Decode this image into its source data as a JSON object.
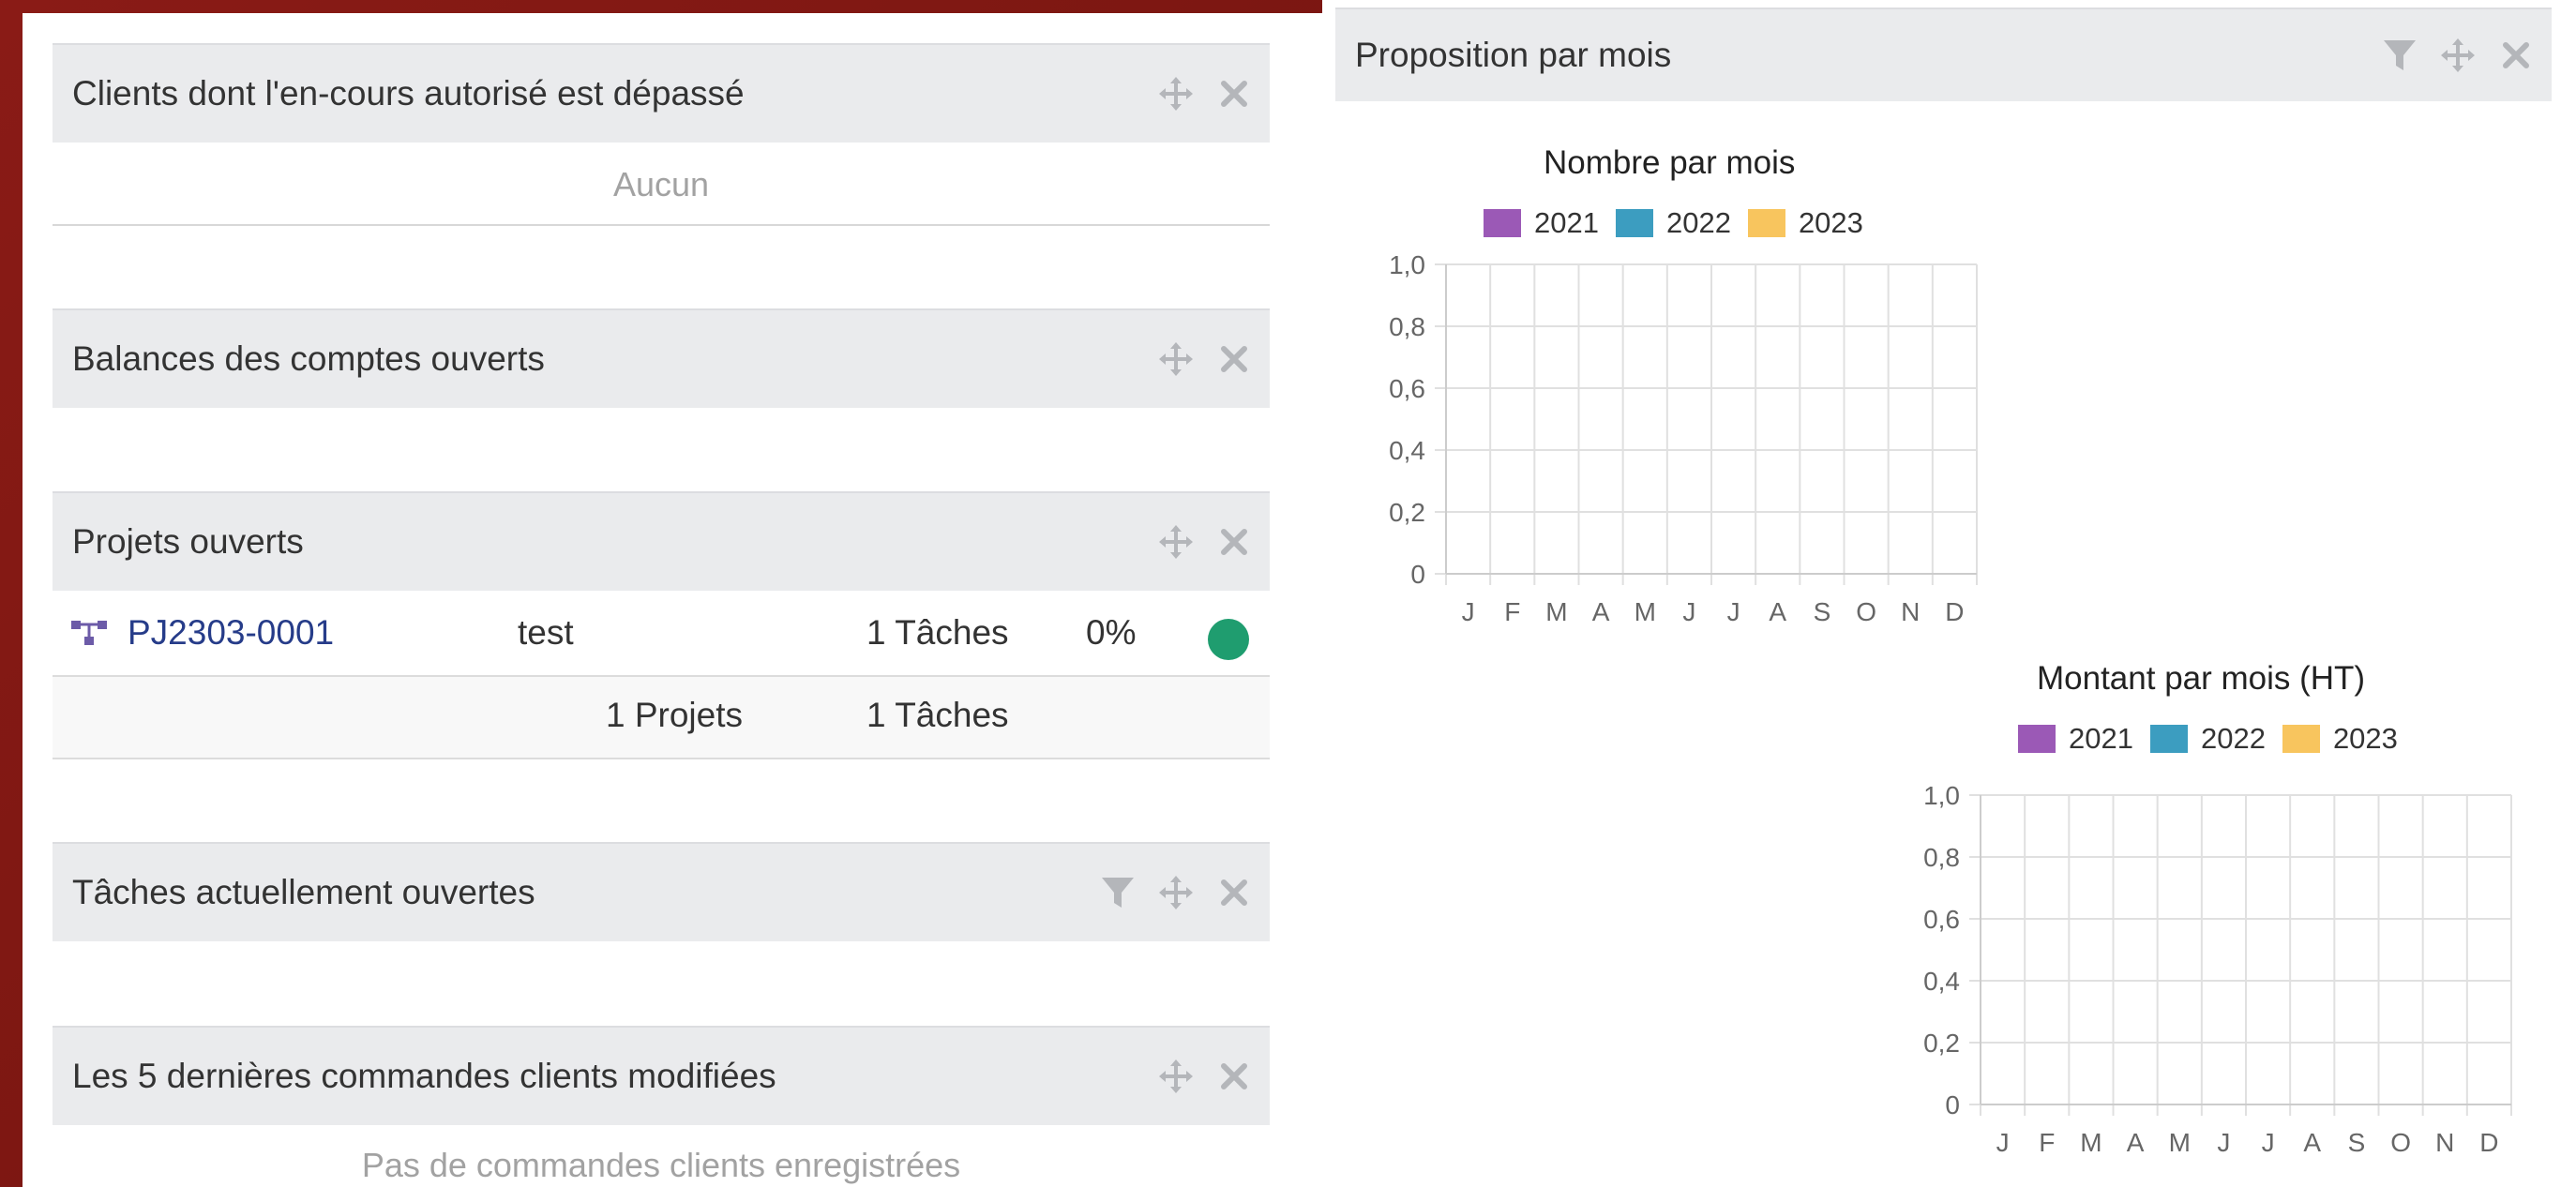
{
  "colors": {
    "header_bg": "#eaebed",
    "link": "#263c89",
    "status_green": "#1f9d6f",
    "series_2021": "#9b59b6",
    "series_2022": "#3c9dc0",
    "series_2023": "#f8c55e",
    "frame": "#8a1b16"
  },
  "widgets": {
    "overdue_clients": {
      "title": "Clients dont l'en-cours autorisé est dépassé",
      "empty": "Aucun"
    },
    "balances": {
      "title": "Balances des comptes ouverts"
    },
    "open_projects": {
      "title": "Projets ouverts",
      "row": {
        "ref": "PJ2303-0001",
        "label": "test",
        "tasks": "1 Tâches",
        "progress": "0%",
        "status": "status-green"
      },
      "totals": {
        "projects": "1 Projets",
        "tasks": "1 Tâches"
      }
    },
    "open_tasks": {
      "title": "Tâches actuellement ouvertes"
    },
    "last_orders": {
      "title": "Les 5 dernières commandes clients modifiées",
      "empty": "Pas de commandes clients enregistrées"
    },
    "proposals": {
      "title": "Proposition par mois"
    }
  },
  "icons": {
    "move": "move-arrows-icon",
    "close": "close-icon",
    "filter": "filter-icon",
    "project": "project-tree-icon"
  },
  "chart_data": [
    {
      "type": "bar",
      "title": "Nombre par mois",
      "categories": [
        "J",
        "F",
        "M",
        "A",
        "M",
        "J",
        "J",
        "A",
        "S",
        "O",
        "N",
        "D"
      ],
      "series": [
        {
          "name": "2021",
          "values": [
            0,
            0,
            0,
            0,
            0,
            0,
            0,
            0,
            0,
            0,
            0,
            0
          ]
        },
        {
          "name": "2022",
          "values": [
            0,
            0,
            0,
            0,
            0,
            0,
            0,
            0,
            0,
            0,
            0,
            0
          ]
        },
        {
          "name": "2023",
          "values": [
            0,
            0,
            0,
            0,
            0,
            0,
            0,
            0,
            0,
            0,
            0,
            0
          ]
        }
      ],
      "yticks": [
        "0",
        "0,2",
        "0,4",
        "0,6",
        "0,8",
        "1,0"
      ],
      "ylim": [
        0,
        1
      ],
      "grid": true,
      "legend": "top"
    },
    {
      "type": "bar",
      "title": "Montant par mois (HT)",
      "categories": [
        "J",
        "F",
        "M",
        "A",
        "M",
        "J",
        "J",
        "A",
        "S",
        "O",
        "N",
        "D"
      ],
      "series": [
        {
          "name": "2021",
          "values": [
            0,
            0,
            0,
            0,
            0,
            0,
            0,
            0,
            0,
            0,
            0,
            0
          ]
        },
        {
          "name": "2022",
          "values": [
            0,
            0,
            0,
            0,
            0,
            0,
            0,
            0,
            0,
            0,
            0,
            0
          ]
        },
        {
          "name": "2023",
          "values": [
            0,
            0,
            0,
            0,
            0,
            0,
            0,
            0,
            0,
            0,
            0,
            0
          ]
        }
      ],
      "yticks": [
        "0",
        "0,2",
        "0,4",
        "0,6",
        "0,8",
        "1,0"
      ],
      "ylim": [
        0,
        1
      ],
      "grid": true,
      "legend": "top"
    }
  ]
}
